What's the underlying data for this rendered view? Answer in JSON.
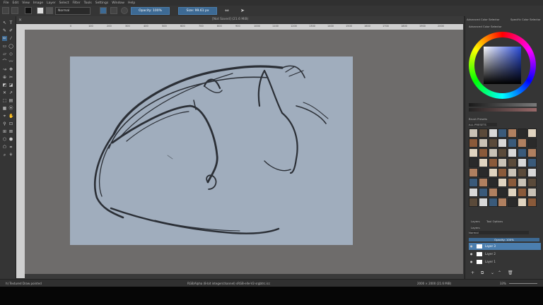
{
  "menu": [
    "File",
    "Edit",
    "View",
    "Image",
    "Layer",
    "Select",
    "Filter",
    "Tools",
    "Settings",
    "Window",
    "Help"
  ],
  "toolbar": {
    "blend_mode": "Normal",
    "opacity_label": "Opacity: 100%",
    "size_label": "Size: 99.61 px"
  },
  "document": {
    "title": "[Not Saved] (21.6 MiB)"
  },
  "ruler": {
    "h_ticks": [
      "0",
      "100",
      "200",
      "300",
      "400",
      "500",
      "600",
      "700",
      "800",
      "900",
      "1000",
      "1100",
      "1200",
      "1300",
      "1400",
      "1500",
      "1600",
      "1700",
      "1800",
      "1900",
      "2000"
    ]
  },
  "docker": {
    "tab_advanced": "Advanced Color Selector",
    "tab_specific": "Specific Color Selector",
    "advanced_title": "Advanced Color Selector",
    "brush_presets_title": "Brush Presets",
    "brush_tag": "ALL PRESETS",
    "layers_tab": "Layers",
    "tool_options_tab": "Tool Options",
    "layers_title": "Layers",
    "layer_blend": "Normal",
    "layer_opacity": "Opacity: 100%",
    "layers": [
      "Layer 3",
      "Layer 2",
      "Layer 1"
    ]
  },
  "status": {
    "brush": "h) Textured Draw pointed",
    "colorspace": "RGB/Alpha (8-bit integer/channel)  sRGB-elle-V2-srgbtrc.icc",
    "dimensions": "2000 × 2000 (21.6 MiB)",
    "zoom": "33%"
  },
  "colors": {
    "canvas": "#a0adbd",
    "workspace": "#6e6c6b",
    "accent": "#3d6a94",
    "stroke": "#2b2f36"
  }
}
